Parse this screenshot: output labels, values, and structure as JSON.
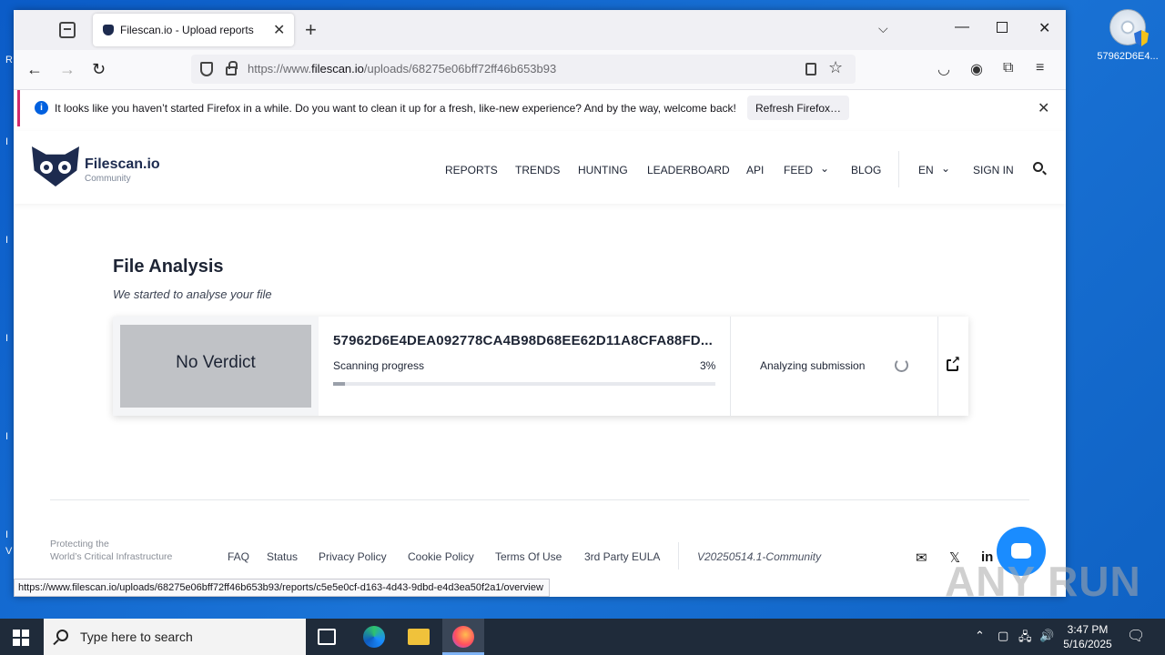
{
  "desktop": {
    "icon_label": "57962D6E4...",
    "edge_letters": [
      "R",
      "I",
      "I",
      "I",
      "I",
      "I",
      "V"
    ]
  },
  "browser": {
    "tab_title": "Filescan.io - Upload reports",
    "url_prefix": "https://www.",
    "url_domain": "filescan.io",
    "url_path": "/uploads/68275e06bff72ff46b653b93",
    "notification": {
      "message": "It looks like you haven’t started Firefox in a while. Do you want to clean it up for a fresh, like-new experience? And by the way, welcome back!",
      "button": "Refresh Firefox…"
    },
    "status_url": "https://www.filescan.io/uploads/68275e06bff72ff46b653b93/reports/c5e5e0cf-d163-4d43-9dbd-e4d3ea50f2a1/overview"
  },
  "site": {
    "brand": "Filescan.io",
    "brand_sub": "Community",
    "nav": [
      "REPORTS",
      "TRENDS",
      "HUNTING",
      "LEADERBOARD",
      "API",
      "FEED",
      "BLOG",
      "EN",
      "SIGN IN"
    ],
    "analysis_title": "File Analysis",
    "analysis_subtitle": "We started to analyse your file",
    "verdict": "No Verdict",
    "hash": "57962D6E4DEA092778CA4B98D68EE62D11A8CFA88FD...",
    "progress_label": "Scanning progress",
    "progress_text": "3%",
    "progress_value": 0.03,
    "status": "Analyzing submission",
    "footer_tagline_1": "Protecting the",
    "footer_tagline_2": "World’s Critical Infrastructure",
    "footer_links": [
      "FAQ",
      "Status",
      "Privacy Policy",
      "Cookie Policy",
      "Terms Of Use",
      "3rd Party EULA"
    ],
    "version": "V20250514.1-Community"
  },
  "watermark": "ANY RUN",
  "taskbar": {
    "search_placeholder": "Type here to search",
    "time": "3:47 PM",
    "date": "5/16/2025"
  },
  "colors": {
    "accent": "#0060df",
    "brand": "#1d2b4f",
    "notification_bar": "#d22b6d",
    "chat": "#1a8cff"
  }
}
